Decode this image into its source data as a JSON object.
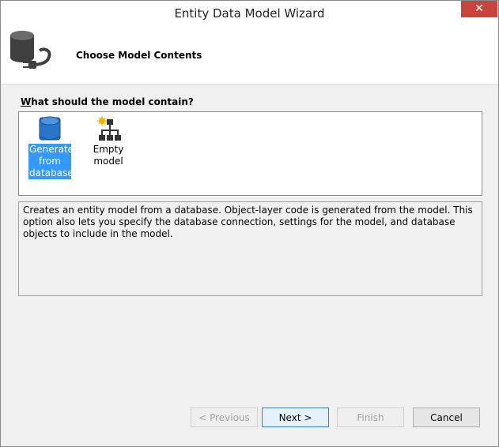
{
  "window": {
    "title": "Entity Data Model Wizard",
    "close_glyph": "✕"
  },
  "header": {
    "title": "Choose Model Contents",
    "icon": "database-plug-icon"
  },
  "question": {
    "accesskey": "W",
    "rest": "hat should the model contain?"
  },
  "options": [
    {
      "label": "Generate from database",
      "icon": "database-icon",
      "selected": true
    },
    {
      "label": "Empty model",
      "icon": "hierarchy-icon",
      "selected": false
    }
  ],
  "description": "Creates an entity model from a database. Object-layer code is generated from the model. This option also lets you specify the database connection, settings for the model, and database objects to include in the model.",
  "buttons": {
    "previous": {
      "label": "< Previous",
      "enabled": false
    },
    "next": {
      "label": "Next >",
      "enabled": true
    },
    "finish": {
      "label": "Finish",
      "enabled": false
    },
    "cancel": {
      "label": "Cancel",
      "enabled": true
    }
  },
  "colors": {
    "selection": "#3399ff",
    "close": "#c7453a",
    "accent_border": "#3c7fb1"
  }
}
